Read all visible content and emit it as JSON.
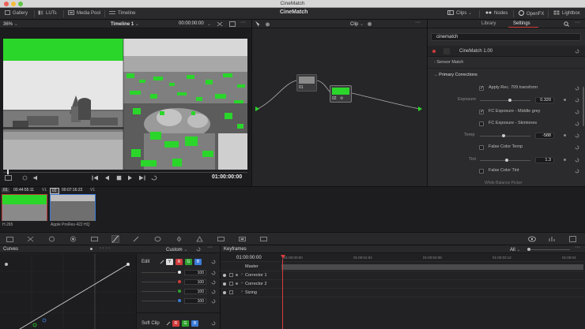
{
  "app": {
    "title": "CineMatch"
  },
  "topbar": {
    "left": [
      {
        "label": "Gallery",
        "icon": "gallery-icon"
      },
      {
        "label": "LUTs",
        "icon": "luts-icon"
      },
      {
        "label": "Media Pool",
        "icon": "media-pool-icon"
      },
      {
        "label": "Timeline",
        "icon": "timeline-icon"
      }
    ],
    "right": [
      {
        "label": "Clips",
        "icon": "clips-icon"
      },
      {
        "label": "Nodes",
        "icon": "nodes-icon"
      },
      {
        "label": "OpenFX",
        "icon": "openfx-icon"
      },
      {
        "label": "Lightbox",
        "icon": "lightbox-icon"
      }
    ]
  },
  "viewer": {
    "zoom": "36%",
    "timeline_name": "Timeline 1",
    "timecode_top": "00:00:00:00",
    "timecode": "01:00:00:00"
  },
  "nodes": {
    "mode": "Clip",
    "node1_label": "01",
    "node2_label": "02"
  },
  "right_panel": {
    "tabs": [
      "Library",
      "Settings"
    ],
    "active_tab": "Settings",
    "search_value": "cinematch",
    "plugin_name": "CineMatch 1.00",
    "sections": {
      "sensor_match": "Sensor Match",
      "primary_corrections": "Primary Corrections"
    },
    "apply_rec709": "Apply Rec. 709 transform",
    "exposure_label": "Exposure",
    "exposure_value": "0.320",
    "fc_middle_grey": "FC Exposure - Middle grey",
    "fc_skintones": "FC Exposure - Skintones",
    "temp_label": "Temp",
    "temp_value": "-588",
    "false_color_temp": "False Color Temp",
    "tint_label": "Tint",
    "tint_value": "1.3",
    "false_color_tint": "False Color Tint",
    "white_balance_picker": "White Balance Picker"
  },
  "clips": [
    {
      "num": "01",
      "timecode": "00:44:55:11",
      "track": "V1",
      "codec": "H.265"
    },
    {
      "num": "02",
      "timecode": "00:07:16:22",
      "track": "V1",
      "codec": "Apple ProRes 422 HQ"
    }
  ],
  "curves": {
    "title": "Curves",
    "mode": "Custom",
    "edit_label": "Edit",
    "channels": [
      "Y",
      "R",
      "G",
      "B"
    ],
    "values": [
      "100",
      "100",
      "100",
      "100"
    ],
    "soft_clip_label": "Soft Clip"
  },
  "keyframes": {
    "title": "Keyframes",
    "filter": "All",
    "timecode": "01:00:00:00",
    "ruler": [
      "01:00:00:00",
      "01:00:01:04",
      "01:00:02:08",
      "01:00:03:12",
      "01:00:04"
    ],
    "tracks": [
      "Master",
      "Corrector 1",
      "Corrector 2",
      "Sizing"
    ]
  },
  "colors": {
    "accent_red": "#d23c3c",
    "false_color_green": "#2bd62b",
    "selection_blue": "#3b7bd8"
  }
}
